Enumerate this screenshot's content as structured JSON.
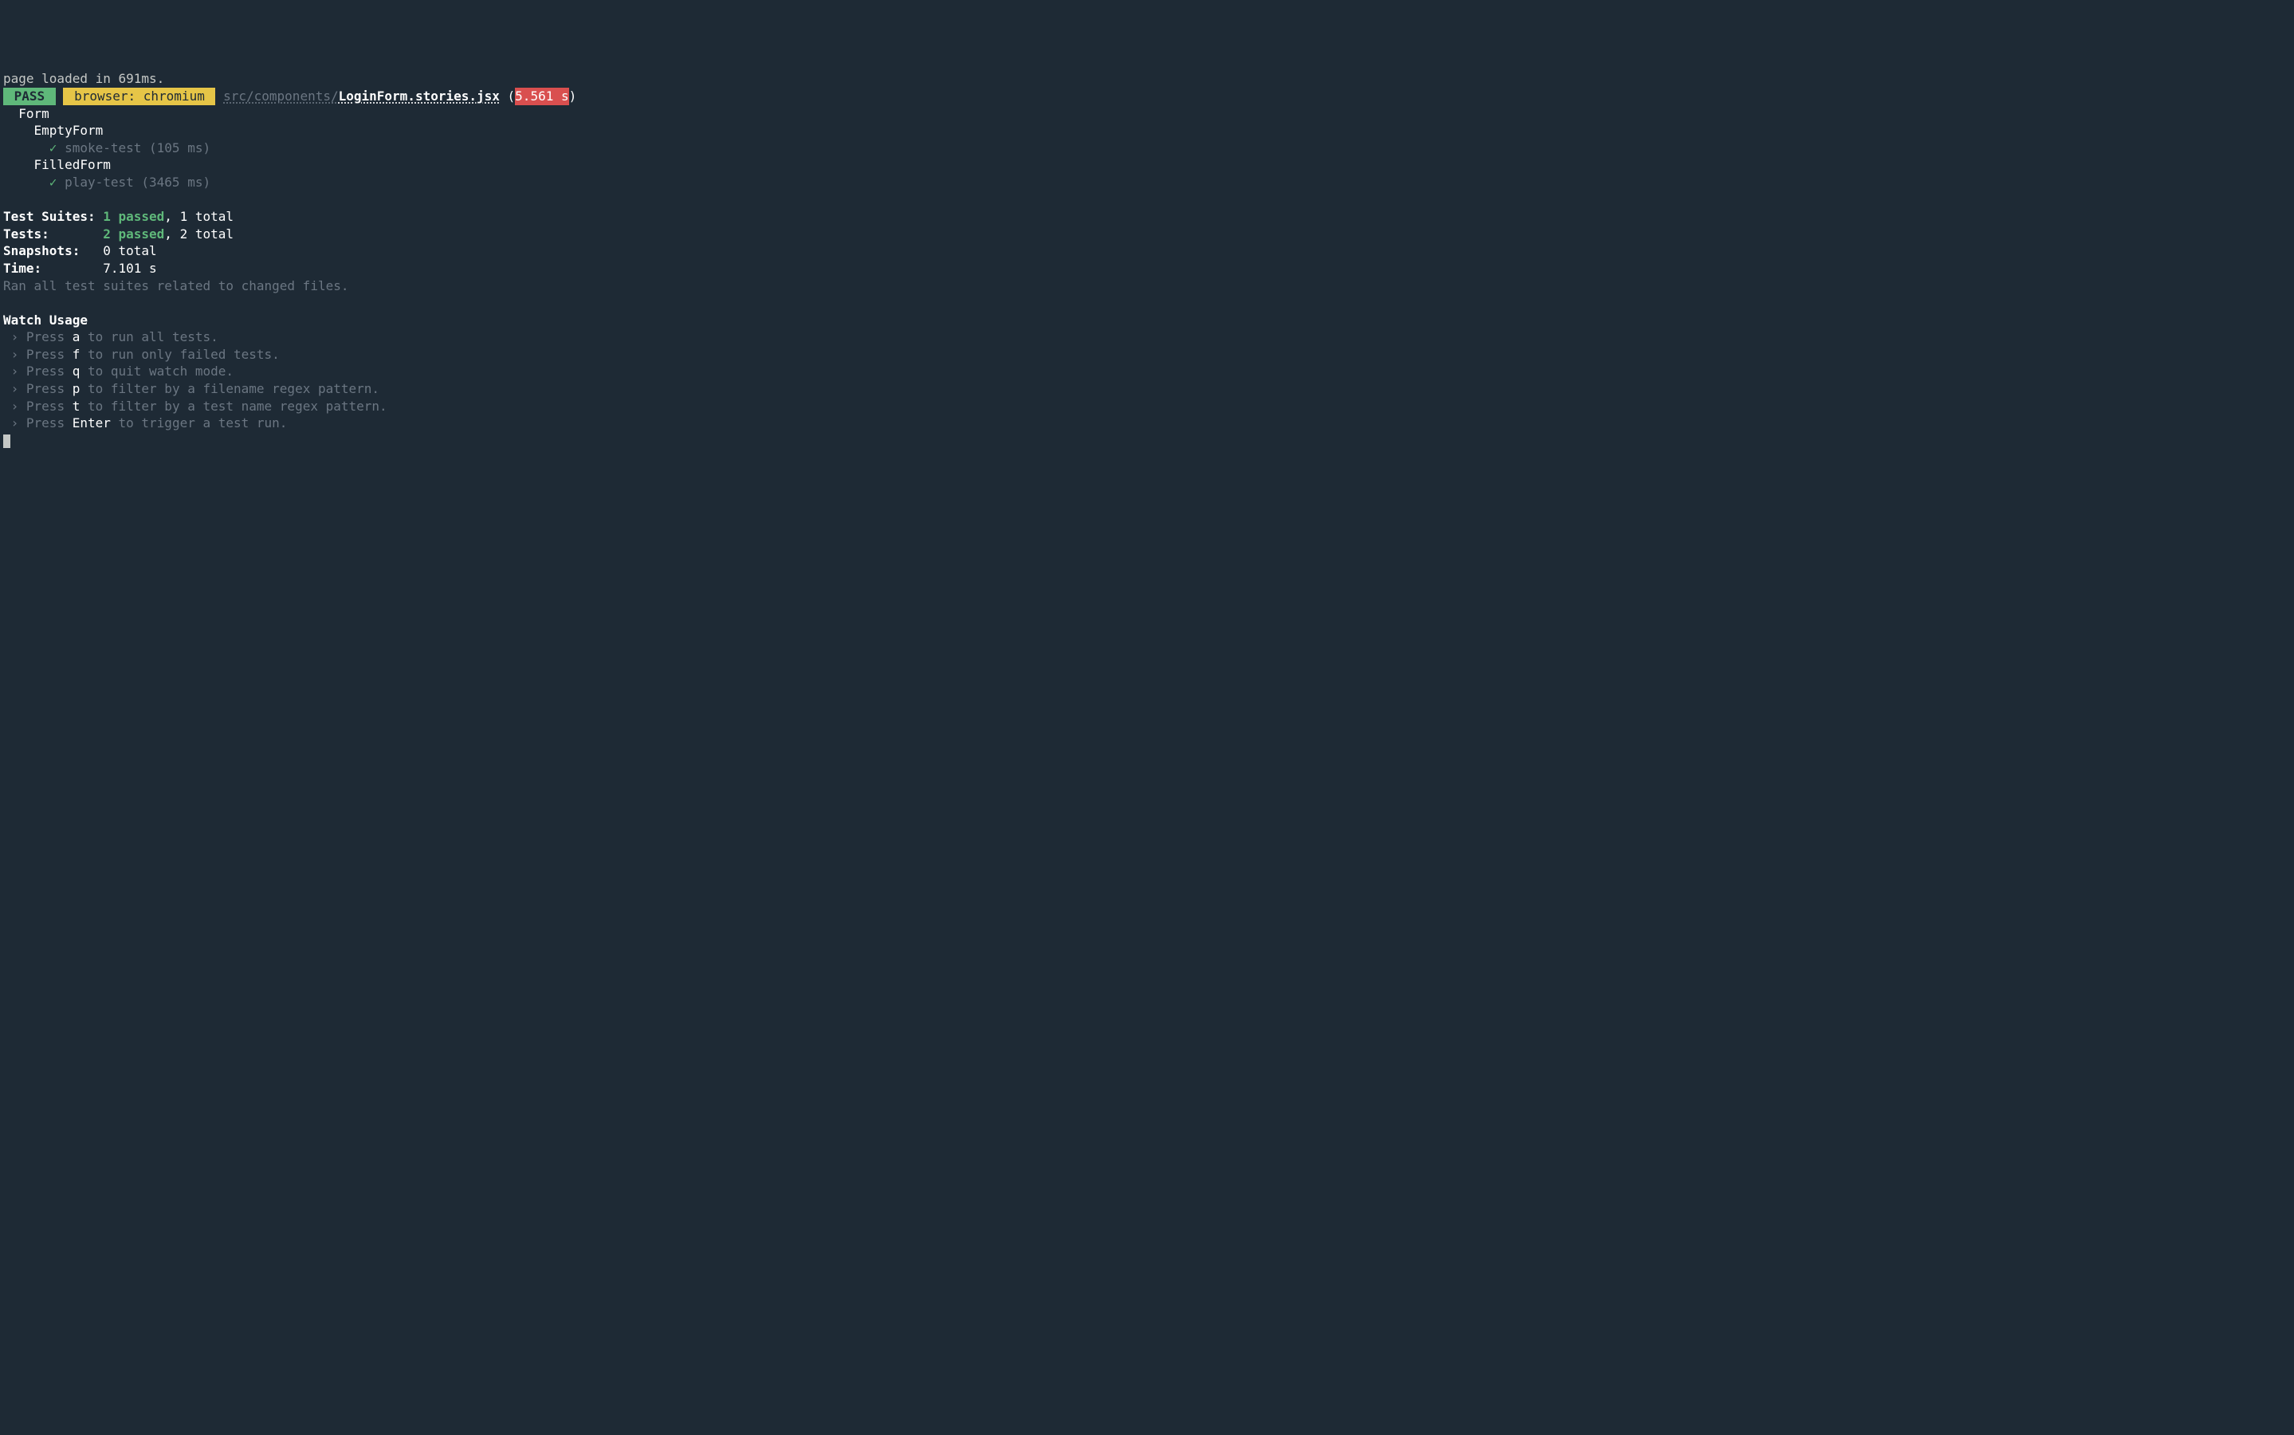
{
  "preamble": "page loaded in 691ms.",
  "header": {
    "pass_badge": " PASS ",
    "browser_badge": " browser: chromium ",
    "path_dir": "src/components/",
    "path_file": "LoginForm.stories.jsx",
    "paren_open": " (",
    "time_badge": "5.561 s",
    "paren_close": ")"
  },
  "tree": {
    "root": "  Form",
    "groups": [
      {
        "name": "    EmptyForm",
        "test_prefix": "      ",
        "check": "✓",
        "test_text": " smoke-test (105 ms)"
      },
      {
        "name": "    FilledForm",
        "test_prefix": "      ",
        "check": "✓",
        "test_text": " play-test (3465 ms)"
      }
    ]
  },
  "summary": {
    "suites_label": "Test Suites: ",
    "suites_passed": "1 passed",
    "suites_rest": ", 1 total",
    "tests_label": "Tests:       ",
    "tests_passed": "2 passed",
    "tests_rest": ", 2 total",
    "snapshots_label": "Snapshots:   ",
    "snapshots_val": "0 total",
    "time_label": "Time:        ",
    "time_val": "7.101 s",
    "ran": "Ran all test suites related to changed files."
  },
  "watch": {
    "heading": "Watch Usage",
    "items": [
      {
        "prefix": " › ",
        "press": "Press ",
        "key": "a",
        "rest": " to run all tests."
      },
      {
        "prefix": " › ",
        "press": "Press ",
        "key": "f",
        "rest": " to run only failed tests."
      },
      {
        "prefix": " › ",
        "press": "Press ",
        "key": "q",
        "rest": " to quit watch mode."
      },
      {
        "prefix": " › ",
        "press": "Press ",
        "key": "p",
        "rest": " to filter by a filename regex pattern."
      },
      {
        "prefix": " › ",
        "press": "Press ",
        "key": "t",
        "rest": " to filter by a test name regex pattern."
      },
      {
        "prefix": " › ",
        "press": "Press ",
        "key": "Enter",
        "rest": " to trigger a test run."
      }
    ]
  }
}
